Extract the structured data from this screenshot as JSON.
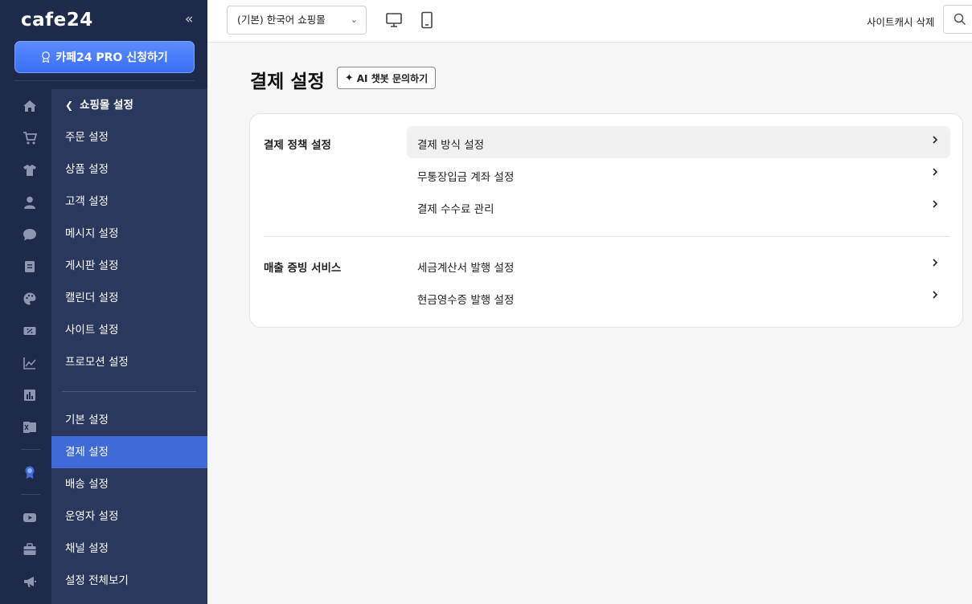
{
  "brand": {
    "logo_text": "cafe24",
    "collapse_glyph": "«"
  },
  "sidebar": {
    "pro_button_label": "카페24 PRO 신청하기",
    "icons": [
      "home-icon",
      "cart-icon",
      "shirt-icon",
      "user-icon",
      "chat-icon",
      "board-icon",
      "palette-icon",
      "promo-icon",
      "chart-icon",
      "stats-icon",
      "excel-icon",
      "medal-icon",
      "youtube-icon",
      "briefcase-icon",
      "megaphone-icon"
    ],
    "back_label": "쇼핑몰 설정",
    "items_top": [
      "주문 설정",
      "상품 설정",
      "고객 설정",
      "메시지 설정",
      "게시판 설정",
      "캘린더 설정",
      "사이트 설정",
      "프로모션 설정"
    ],
    "items_bottom": [
      "기본 설정",
      "결제 설정",
      "배송 설정",
      "운영자 설정",
      "채널 설정",
      "설정 전체보기"
    ],
    "active_item": "결제 설정"
  },
  "topbar": {
    "shop_select_value": "(기본) 한국어 쇼핑몰",
    "cache_label": "사이트캐시 삭제"
  },
  "main": {
    "title": "결제 설정",
    "ai_button_label": "AI 챗봇 문의하기",
    "sections": [
      {
        "title": "결제 정책 설정",
        "rows": [
          "결제 방식 설정",
          "무통장입금 계좌 설정",
          "결제 수수료 관리"
        ]
      },
      {
        "title": "매출 증빙 서비스",
        "rows": [
          "세금계산서 발행 설정",
          "현금영수증 발행 설정"
        ]
      }
    ]
  },
  "colors": {
    "sidebar_bg": "#1e2a4a",
    "submenu_bg": "#2b385e",
    "active": "#3f6ad8",
    "pro_button": "#4a7cf8"
  }
}
